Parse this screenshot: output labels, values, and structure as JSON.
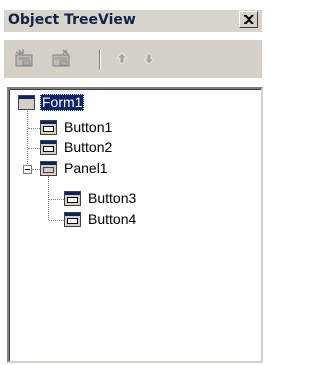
{
  "window": {
    "title": "Object TreeView",
    "close_icon": "close-icon"
  },
  "toolbar": {
    "buttons": [
      {
        "icon": "insert-component-icon",
        "enabled": false
      },
      {
        "icon": "delete-component-icon",
        "enabled": false
      },
      {
        "icon": "move-up-icon",
        "enabled": false
      },
      {
        "icon": "move-down-icon",
        "enabled": false
      }
    ]
  },
  "tree": {
    "nodes": [
      {
        "label": "Form1",
        "icon": "form-icon",
        "selected": true,
        "level": 0
      },
      {
        "label": "Button1",
        "icon": "button-component-icon",
        "selected": false,
        "level": 1
      },
      {
        "label": "Button2",
        "icon": "button-component-icon",
        "selected": false,
        "level": 1
      },
      {
        "label": "Panel1",
        "icon": "panel-component-icon",
        "selected": false,
        "level": 1,
        "expanded": true
      },
      {
        "label": "Button3",
        "icon": "button-component-icon",
        "selected": false,
        "level": 2
      },
      {
        "label": "Button4",
        "icon": "button-component-icon",
        "selected": false,
        "level": 2
      }
    ]
  },
  "colors": {
    "selection_bg": "#0a246a",
    "title_text": "#10244a",
    "face": "#d4d0c8"
  }
}
